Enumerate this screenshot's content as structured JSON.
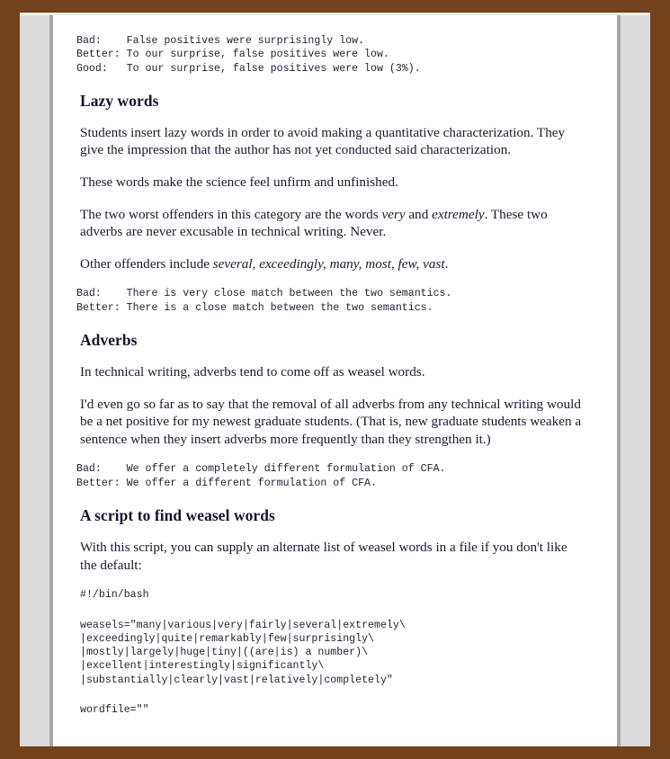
{
  "document": {
    "colors": {
      "page_border": "#73421a",
      "gutter": "#dcdcdc",
      "gutter_rule": "#a3a7a7",
      "paper": "#ffffff",
      "text": "#1b1b30",
      "code_text": "#232334"
    },
    "blocks": {
      "sample_false_positives": "Bad:    False positives were surprisingly low.\nBetter: To our surprise, false positives were low.\nGood:   To our surprise, false positives were low (3%).",
      "lazy_words_heading": "Lazy words",
      "lazy_words_p1": "Students insert lazy words in order to avoid making a quantitative characterization. They give the impression that the author has not yet conducted said characterization.",
      "lazy_words_p2": "These words make the science feel unfirm and unfinished.",
      "lazy_words_p3_part1": "The two worst offenders in this category are the words ",
      "lazy_words_p3_em1": "very",
      "lazy_words_p3_part2": " and ",
      "lazy_words_p3_em2": "extremely",
      "lazy_words_p3_part3": ". These two adverbs are never excusable in technical writing. Never.",
      "lazy_words_p4_part1": "Other offenders include ",
      "lazy_words_p4_em": "several, exceedingly, many, most, few, vast",
      "lazy_words_p4_part2": ".",
      "sample_close_match": "Bad:    There is very close match between the two semantics.\nBetter: There is a close match between the two semantics.",
      "adverbs_heading": "Adverbs",
      "adverbs_p1": "In technical writing, adverbs tend to come off as weasel words.",
      "adverbs_p2": "I'd even go so far as to say that the removal of all adverbs from any technical writing would be a net positive for my newest graduate students. (That is, new graduate students weaken a sentence when they insert adverbs more frequently than they strengthen it.)",
      "sample_cfa": "Bad:    We offer a completely different formulation of CFA.\nBetter: We offer a different formulation of CFA.",
      "script_heading": "A script to find weasel words",
      "script_p1": "With this script, you can supply an alternate list of weasel words in a file if you don't like the default:",
      "script_shebang": "#!/bin/bash",
      "script_weasels": "weasels=\"many|various|very|fairly|several|extremely\\\n|exceedingly|quite|remarkably|few|surprisingly\\\n|mostly|largely|huge|tiny|((are|is) a number)\\\n|excellent|interestingly|significantly\\\n|substantially|clearly|vast|relatively|completely\"",
      "script_wordfile": "wordfile=\"\""
    }
  }
}
